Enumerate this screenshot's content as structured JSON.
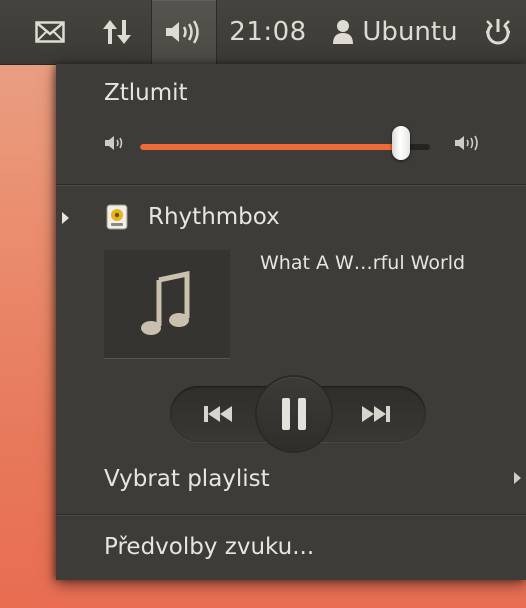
{
  "panel": {
    "clock": "21:08",
    "user": "Ubuntu",
    "icons": [
      "mail-icon",
      "network-icon",
      "volume-icon",
      "user-icon",
      "power-icon"
    ]
  },
  "sound_menu": {
    "mute_label": "Ztlumit",
    "volume_level": 0.9,
    "player": {
      "name": "Rhythmbox",
      "track_title": "What A W…rful World",
      "state": "playing"
    },
    "playlist_label": "Vybrat playlist",
    "settings_label": "Předvolby zvuku..."
  },
  "colors": {
    "panel": "#3b3a36",
    "menu": "#3d3c38",
    "accent": "#ef6a37",
    "text": "#e8e5de"
  }
}
